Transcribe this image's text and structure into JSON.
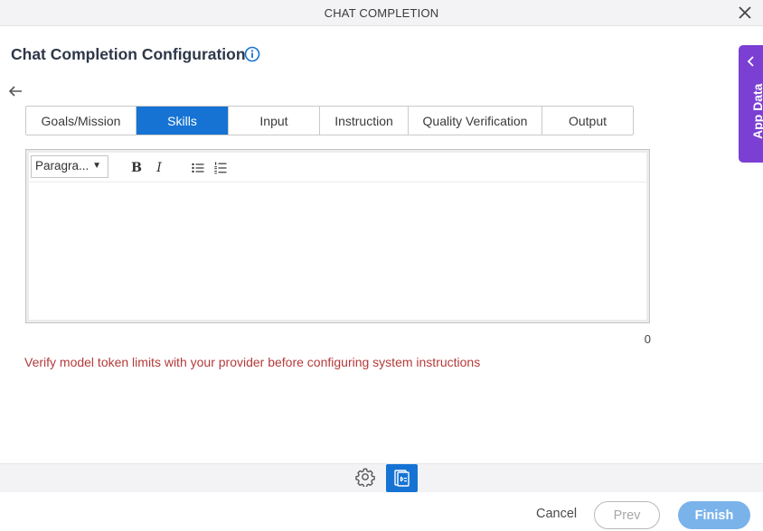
{
  "window": {
    "title": "CHAT COMPLETION",
    "close_icon": "close-icon"
  },
  "page": {
    "title": "Chat Completion Configuration",
    "info_icon": "info-icon",
    "back_icon": "arrow-left-icon"
  },
  "tabs": [
    {
      "label": "Goals/Mission",
      "active": false
    },
    {
      "label": "Skills",
      "active": true
    },
    {
      "label": "Input",
      "active": false
    },
    {
      "label": "Instruction",
      "active": false
    },
    {
      "label": "Quality Verification",
      "active": false
    },
    {
      "label": "Output",
      "active": false
    }
  ],
  "editor": {
    "paragraph_select": "Paragra...",
    "bold_label": "B",
    "italic_label": "I",
    "bullet_list_icon": "bullet-list-icon",
    "numbered_list_icon": "numbered-list-icon",
    "content": "",
    "char_count": "0"
  },
  "warning": {
    "text": "Verify model token limits with your provider before configuring system instructions",
    "color": "#b33a3a"
  },
  "side_panel": {
    "label": "App Data",
    "color": "#7b3fd3"
  },
  "bottom_toolbar": {
    "settings_icon": "gear-icon",
    "document_icon": "document-icon"
  },
  "footer": {
    "cancel_label": "Cancel",
    "prev_label": "Prev",
    "finish_label": "Finish"
  },
  "colors": {
    "accent": "#1673d4",
    "finish_disabled": "#7ab3ea"
  }
}
